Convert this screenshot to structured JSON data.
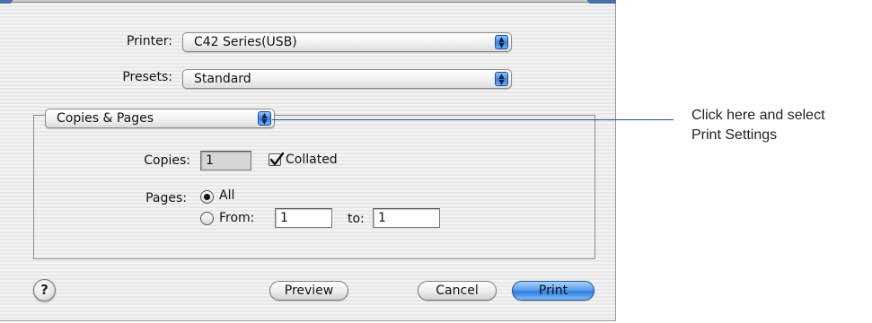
{
  "printer": {
    "label": "Printer:",
    "value": "C42 Series(USB)"
  },
  "presets": {
    "label": "Presets:",
    "value": "Standard"
  },
  "panel_menu": {
    "value": "Copies & Pages"
  },
  "copies": {
    "label": "Copies:",
    "value": "1",
    "collated_label": "Collated",
    "collated_checked": true
  },
  "pages": {
    "label": "Pages:",
    "all_label": "All",
    "all_selected": true,
    "from_label": "From:",
    "from_value": "1",
    "to_label": "to:",
    "to_value": "1"
  },
  "buttons": {
    "help": "?",
    "preview": "Preview",
    "cancel": "Cancel",
    "print": "Print"
  },
  "callout": {
    "line1": "Click here and select",
    "line2": "Print Settings"
  },
  "colors": {
    "accent": "#3b86e0",
    "callout_line": "#2b4d9a"
  }
}
